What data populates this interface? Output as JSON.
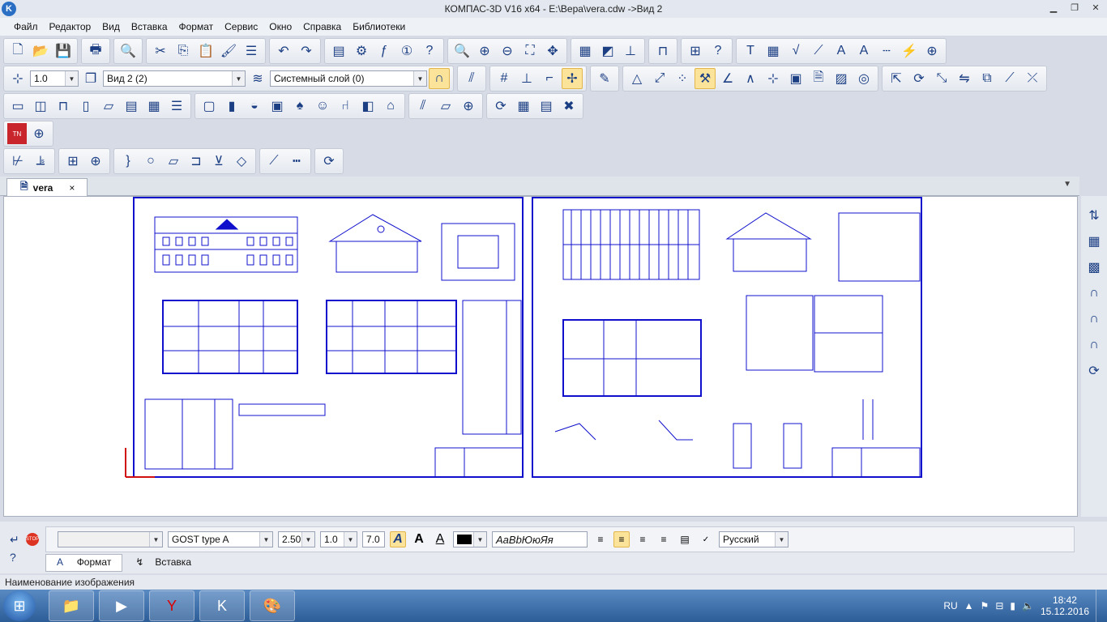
{
  "window": {
    "title": "КОМПАС-3D V16  x64 - E:\\Вера\\vera.cdw ->Вид 2",
    "app_icon": "kompas-logo-icon"
  },
  "menu": [
    "Файл",
    "Редактор",
    "Вид",
    "Вставка",
    "Формат",
    "Сервис",
    "Окно",
    "Справка",
    "Библиотеки"
  ],
  "toolbar2": {
    "line_width": "1.0",
    "view": "Вид 2 (2)",
    "layer": "Системный слой (0)"
  },
  "document": {
    "tab_label": "vera",
    "tab_close": "×"
  },
  "properties": {
    "font_name": "GOST type A",
    "height": "2.50",
    "width": "1.0",
    "step": "7.0",
    "sample": "АаВbЮюЯя",
    "language": "Русский",
    "tab_format": "Формат",
    "tab_insert": "Вставка"
  },
  "status": {
    "text": "Наименование изображения"
  },
  "taskbar": {
    "lang": "RU",
    "time": "18:42",
    "date": "15.12.2016"
  },
  "colors": {
    "drawing": "#1010cc",
    "accent": "#2a6fc4"
  }
}
